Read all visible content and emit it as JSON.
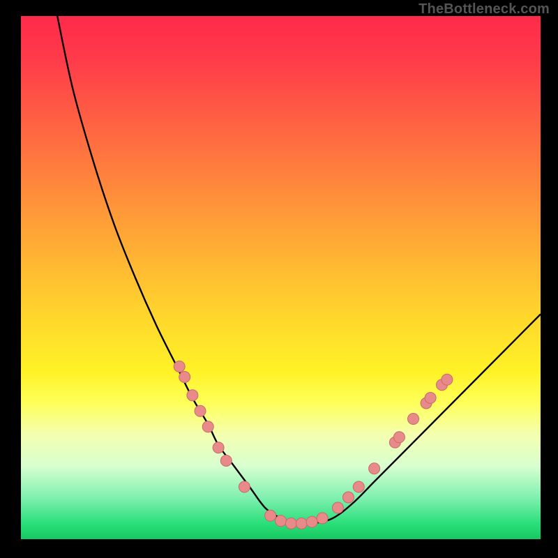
{
  "watermark": "TheBottleneck.com",
  "colors": {
    "frame": "#000000",
    "curve_stroke": "#000000",
    "marker_fill": "#e88a8a",
    "marker_stroke": "#c86a6a"
  },
  "chart_data": {
    "type": "line",
    "title": "",
    "xlabel": "",
    "ylabel": "",
    "xlim": [
      0,
      100
    ],
    "ylim": [
      0,
      100
    ],
    "grid": false,
    "legend": false,
    "series": [
      {
        "name": "curve",
        "x": [
          7,
          10,
          14,
          18,
          22,
          26,
          30,
          33,
          36,
          38,
          41,
          44,
          47,
          50,
          53,
          56,
          60,
          64,
          68,
          73,
          79,
          86,
          94,
          100
        ],
        "y": [
          100,
          86,
          72,
          60,
          50,
          41,
          33,
          27,
          22,
          18,
          14,
          10,
          6,
          4,
          3,
          3,
          4,
          7,
          11,
          16,
          22,
          29,
          37,
          43
        ]
      }
    ],
    "markers": [
      {
        "x": 30.5,
        "y": 33.0
      },
      {
        "x": 31.5,
        "y": 31.0
      },
      {
        "x": 33.0,
        "y": 27.5
      },
      {
        "x": 34.5,
        "y": 24.5
      },
      {
        "x": 36.0,
        "y": 21.5
      },
      {
        "x": 38.0,
        "y": 17.5
      },
      {
        "x": 39.5,
        "y": 15.0
      },
      {
        "x": 43.0,
        "y": 10.0
      },
      {
        "x": 48.0,
        "y": 4.5
      },
      {
        "x": 50.0,
        "y": 3.5
      },
      {
        "x": 52.0,
        "y": 3.0
      },
      {
        "x": 54.0,
        "y": 3.0
      },
      {
        "x": 56.0,
        "y": 3.3
      },
      {
        "x": 58.0,
        "y": 4.0
      },
      {
        "x": 61.0,
        "y": 6.0
      },
      {
        "x": 63.0,
        "y": 8.0
      },
      {
        "x": 65.0,
        "y": 10.0
      },
      {
        "x": 68.0,
        "y": 13.5
      },
      {
        "x": 72.0,
        "y": 18.5
      },
      {
        "x": 72.8,
        "y": 19.5
      },
      {
        "x": 75.5,
        "y": 23.0
      },
      {
        "x": 78.0,
        "y": 26.0
      },
      {
        "x": 78.8,
        "y": 27.0
      },
      {
        "x": 81.0,
        "y": 29.5
      },
      {
        "x": 82.0,
        "y": 30.5
      }
    ]
  }
}
